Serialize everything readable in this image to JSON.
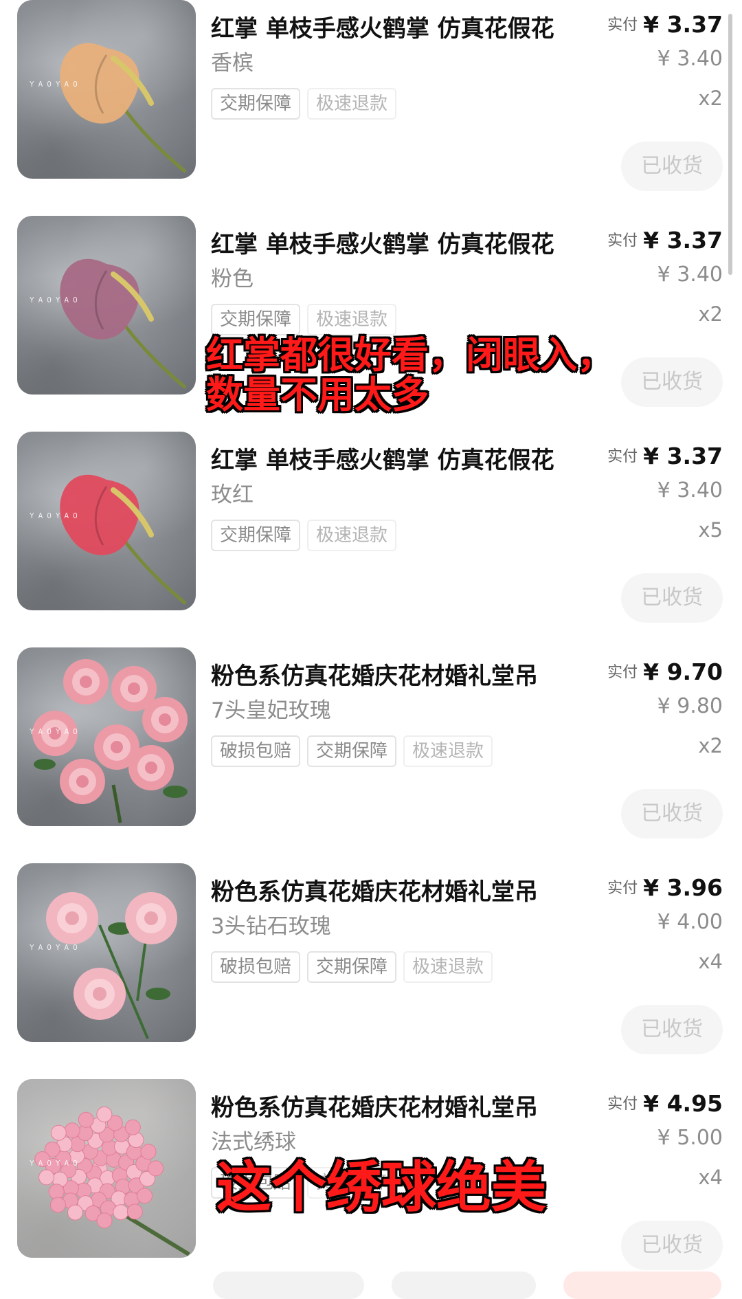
{
  "paid_label": "实付",
  "received_label": "已收货",
  "items": [
    {
      "title": "红掌 单枝手感火鹤掌 仿真花假花",
      "spec": "香槟",
      "paid": "¥ 3.37",
      "orig": "¥ 3.40",
      "qty": "x2",
      "tags": [
        "交期保障",
        "极速退款"
      ],
      "flower": "anthurium",
      "color": "#e8b07a",
      "watermark": "YAOYAO"
    },
    {
      "title": "红掌 单枝手感火鹤掌 仿真花假花",
      "spec": "粉色",
      "paid": "¥ 3.37",
      "orig": "¥ 3.40",
      "qty": "x2",
      "tags": [
        "交期保障",
        "极速退款"
      ],
      "flower": "anthurium",
      "color": "#a86a86",
      "watermark": "YAOYAO"
    },
    {
      "title": "红掌 单枝手感火鹤掌 仿真花假花",
      "spec": "玫红",
      "paid": "¥ 3.37",
      "orig": "¥ 3.40",
      "qty": "x5",
      "tags": [
        "交期保障",
        "极速退款"
      ],
      "flower": "anthurium",
      "color": "#e24a5e",
      "watermark": "YAOYAO"
    },
    {
      "title": "粉色系仿真花婚庆花材婚礼堂吊",
      "spec": "7头皇妃玫瑰",
      "paid": "¥ 9.70",
      "orig": "¥ 9.80",
      "qty": "x2",
      "tags": [
        "破损包赔",
        "交期保障",
        "极速退款"
      ],
      "flower": "roses",
      "color": "#eb9aa6",
      "watermark": "YAOYAO"
    },
    {
      "title": "粉色系仿真花婚庆花材婚礼堂吊",
      "spec": "3头钻石玫瑰",
      "paid": "¥ 3.96",
      "orig": "¥ 4.00",
      "qty": "x4",
      "tags": [
        "破损包赔",
        "交期保障",
        "极速退款"
      ],
      "flower": "roses3",
      "color": "#f2b6c0",
      "watermark": "YAOYAO"
    },
    {
      "title": "粉色系仿真花婚庆花材婚礼堂吊",
      "spec": "法式绣球",
      "paid": "¥ 4.95",
      "orig": "¥ 5.00",
      "qty": "x4",
      "tags": [
        "破损包赔",
        "交期保障"
      ],
      "flower": "hydrangea",
      "color": "#ee9fb4",
      "watermark": "YAOYAO"
    }
  ],
  "overlay1": {
    "line1": "红掌都很好看，闭眼入，",
    "line2": "数量不用太多"
  },
  "overlay2": "这个绣球绝美"
}
